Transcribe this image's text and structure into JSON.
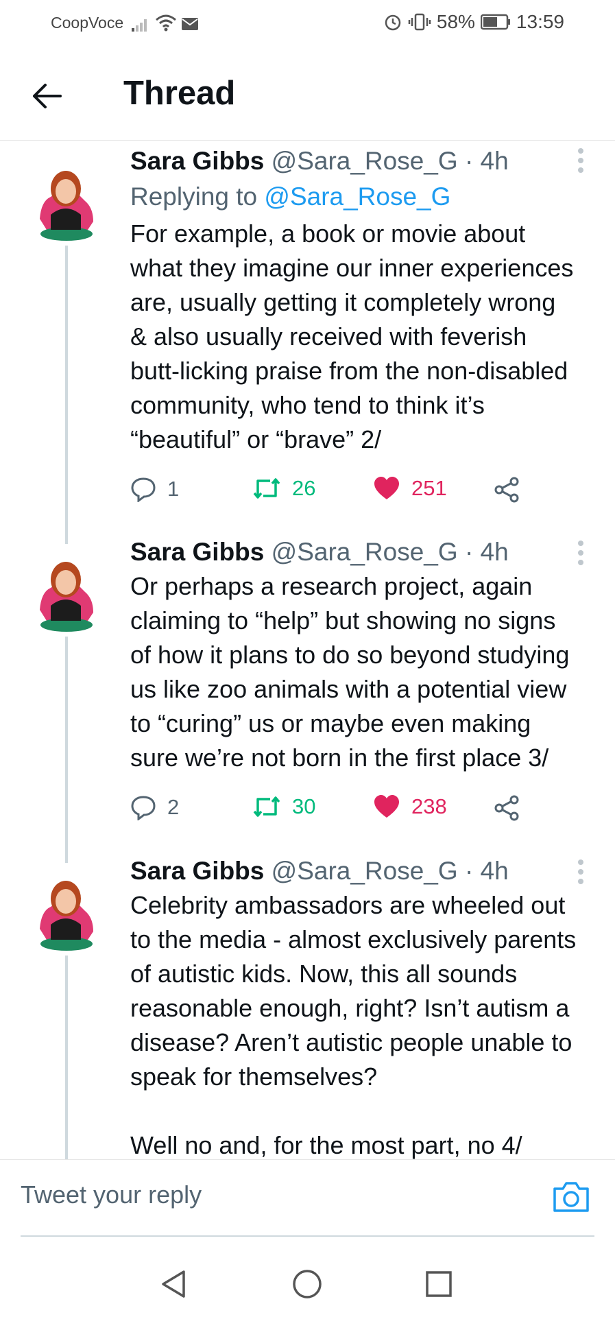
{
  "status_bar": {
    "carrier": "CoopVoce",
    "battery": "58%",
    "time": "13:59"
  },
  "header": {
    "title": "Thread",
    "back_icon": "arrow-left-icon"
  },
  "tweets": [
    {
      "author_name": "Sara Gibbs",
      "author_handle": "@Sara_Rose_G · 4h",
      "replying_prefix": "Replying to ",
      "replying_to": "@Sara_Rose_G",
      "text": "For example, a book or movie about\nwhat they imagine our inner experiences\nare, usually getting it completely wrong\n& also usually received with feverish\nbutt-licking praise from the non-disabled\ncommunity, who tend to think it’s\n“beautiful” or “brave” 2/",
      "replies": "1",
      "retweets": "26",
      "likes": "251"
    },
    {
      "author_name": "Sara Gibbs",
      "author_handle": "@Sara_Rose_G · 4h",
      "text": "Or perhaps a research project, again\nclaiming to “help” but showing no signs\nof how it plans to do so beyond studying\nus like zoo animals with a potential view\nto “curing” us or maybe even making\nsure we’re not born in the first place 3/",
      "replies": "2",
      "retweets": "30",
      "likes": "238"
    },
    {
      "author_name": "Sara Gibbs",
      "author_handle": "@Sara_Rose_G · 4h",
      "text": "Celebrity ambassadors are wheeled out\nto the media - almost exclusively parents\nof autistic kids. Now, this all sounds\nreasonable enough, right? Isn’t autism a\ndisease? Aren’t autistic people unable to\nspeak for themselves?\n\nWell no and, for the most part, no 4/"
    }
  ],
  "reply_bar": {
    "placeholder": "Tweet your reply"
  },
  "colors": {
    "accent": "#1d9bf0",
    "retweet": "#00ba7c",
    "like": "#e0245e"
  }
}
